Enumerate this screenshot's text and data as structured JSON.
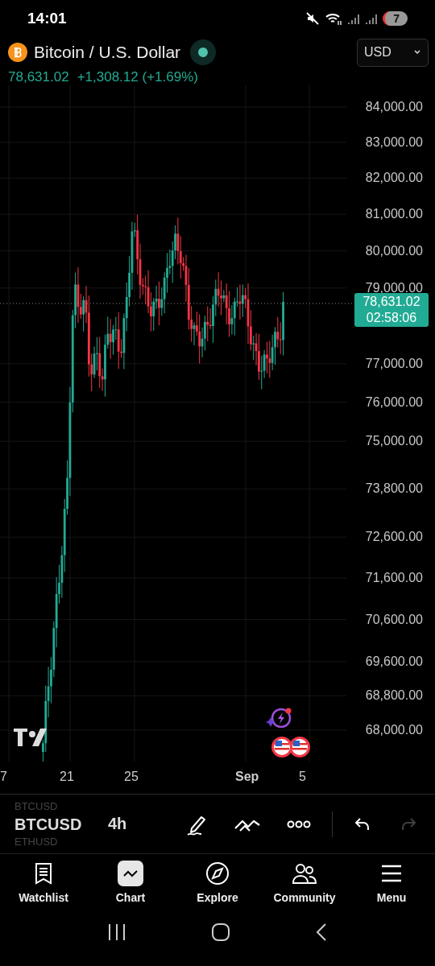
{
  "status_bar": {
    "time": "14:01",
    "notification_count": "7"
  },
  "header": {
    "symbol_name": "Bitcoin / U.S. Dollar",
    "market_open": true,
    "price": "78,631.02",
    "change": "+1,308.12 (+1.69%)",
    "currency": "USD"
  },
  "chart": {
    "price_axis": [
      "84,000.00",
      "83,000.00",
      "82,000.00",
      "81,000.00",
      "80,000.00",
      "79,000.00",
      "77,000.00",
      "76,000.00",
      "75,000.00",
      "73,800.00",
      "72,600.00",
      "71,600.00",
      "70,600.00",
      "69,600.00",
      "68,800.00",
      "68,000.00"
    ],
    "time_axis": [
      {
        "label": "7",
        "bold": false
      },
      {
        "label": "21",
        "bold": false
      },
      {
        "label": "25",
        "bold": false
      },
      {
        "label": "Sep",
        "bold": true
      },
      {
        "label": "5",
        "bold": false
      }
    ],
    "last_price": "78,631.02",
    "countdown": "02:58:06"
  },
  "toolbar": {
    "watchlist_above": "BTCUSD",
    "symbol": "BTCUSD",
    "interval": "4h",
    "watchlist_below": "ETHUSD",
    "history": [
      {
        "kind": "undo",
        "disabled": false
      },
      {
        "kind": "redo",
        "disabled": true
      }
    ]
  },
  "tabs": [
    {
      "label": "Watchlist",
      "kind": "watchlist",
      "selected": false
    },
    {
      "label": "Chart",
      "kind": "chart",
      "selected": true
    },
    {
      "label": "Explore",
      "kind": "explore",
      "selected": false
    },
    {
      "label": "Community",
      "kind": "community",
      "selected": false
    },
    {
      "label": "Menu",
      "kind": "menu",
      "selected": false
    }
  ]
}
